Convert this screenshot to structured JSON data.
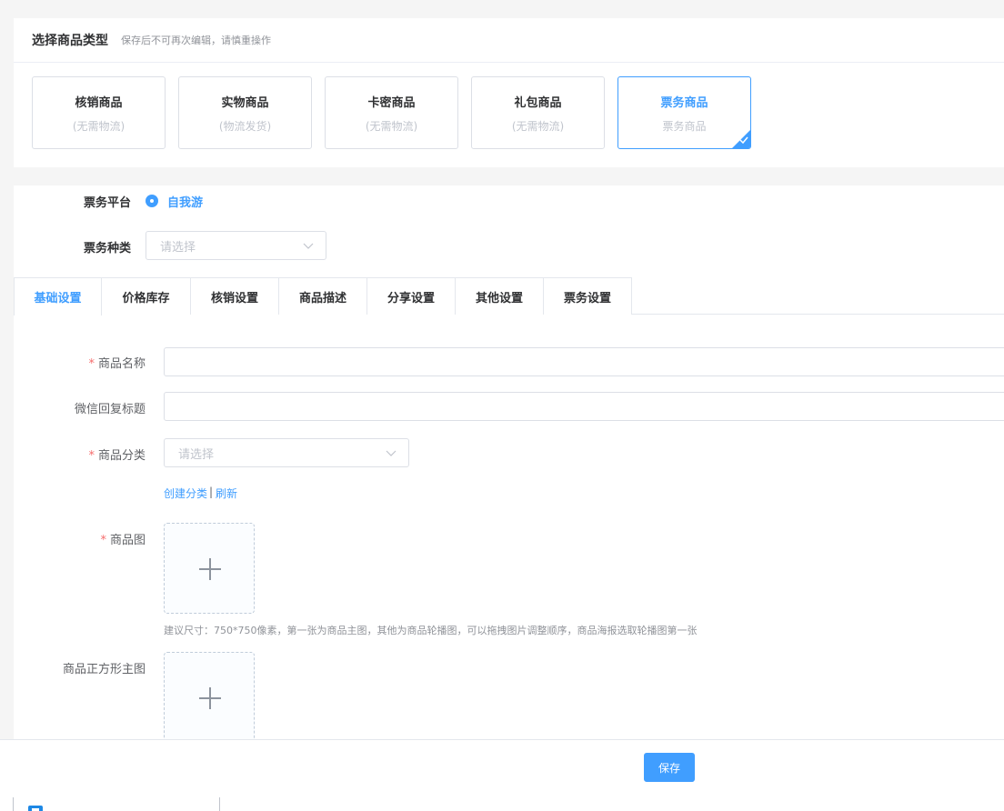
{
  "type_select": {
    "title": "选择商品类型",
    "hint": "保存后不可再次编辑，请慎重操作",
    "options": [
      {
        "name": "核销商品",
        "sub": "(无需物流)"
      },
      {
        "name": "实物商品",
        "sub": "(物流发货)"
      },
      {
        "name": "卡密商品",
        "sub": "(无需物流)"
      },
      {
        "name": "礼包商品",
        "sub": "(无需物流)"
      },
      {
        "name": "票务商品",
        "sub": "票务商品"
      }
    ],
    "selected": "票务商品"
  },
  "ticket": {
    "platform_label": "票务平台",
    "platform_value": "自我游",
    "kind_label": "票务种类",
    "kind_placeholder": "请选择"
  },
  "tabs": [
    "基础设置",
    "价格库存",
    "核销设置",
    "商品描述",
    "分享设置",
    "其他设置",
    "票务设置"
  ],
  "active_tab": "基础设置",
  "form": {
    "name_label": "商品名称",
    "name_value": "",
    "wechat_title_label": "微信回复标题",
    "wechat_title_value": "",
    "category_label": "商品分类",
    "category_placeholder": "请选择",
    "create_category_link": "创建分类",
    "link_separator": "|",
    "refresh_link": "刷新",
    "image_label": "商品图",
    "image_tip": "建议尺寸：750*750像素，第一张为商品主图，其他为商品轮播图，可以拖拽图片调整顺序，商品海报选取轮播图第一张",
    "square_image_label": "商品正方形主图",
    "required_mark": "*"
  },
  "footer": {
    "save_label": "保存"
  },
  "colors": {
    "primary": "#409eff",
    "required": "#f56c6c",
    "border": "#dcdfe6"
  },
  "icons": [
    "check-icon",
    "chevron-down-icon",
    "plus-icon",
    "app-icon"
  ]
}
